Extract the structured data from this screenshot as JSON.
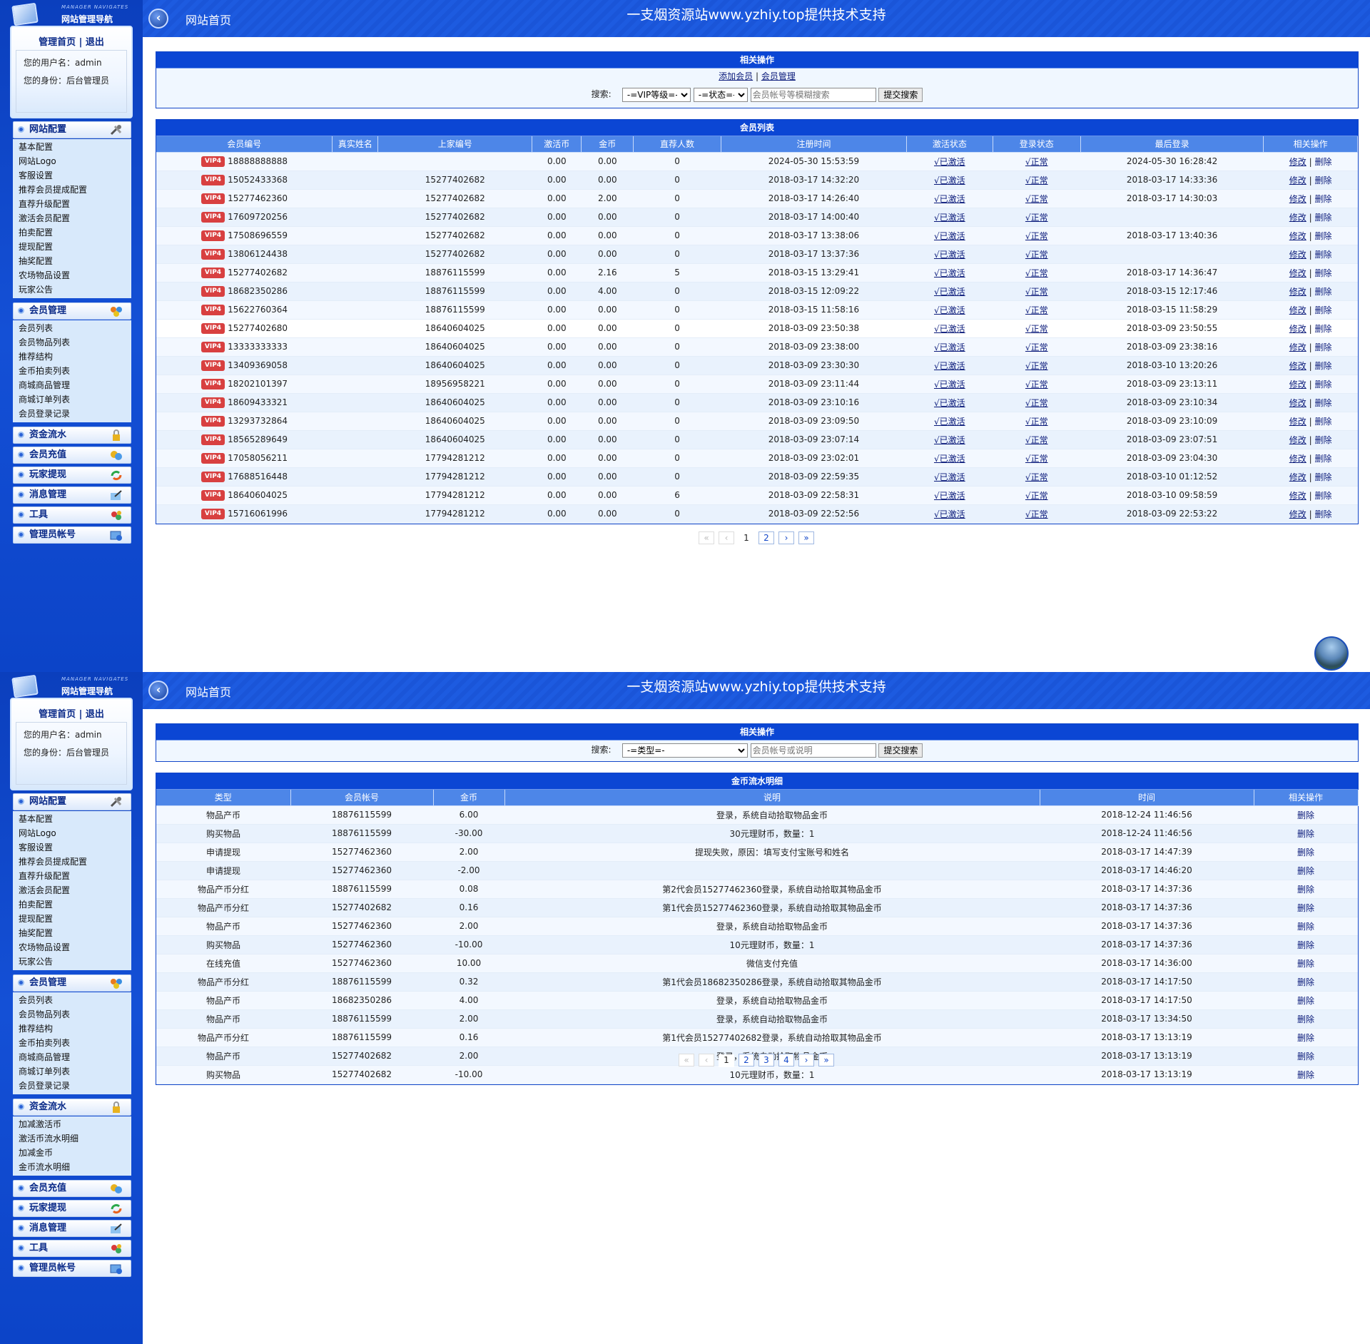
{
  "common": {
    "logo_sub": "MANAGER NAVIGATES",
    "logo_title": "网站管理导航",
    "admin_home": "管理首页",
    "sep": "|",
    "logout": "退出",
    "username_line": "您的用户名：admin",
    "role_line": "您的身份：后台管理员",
    "breadcrumb": "网站首页",
    "banner": "一支烟资源站www.yzhiy.top提供技术支持",
    "back_icon": "chevron-left-icon"
  },
  "menu": {
    "site_config": {
      "label": "网站配置",
      "items": [
        "基本配置",
        "网站Logo",
        "客服设置",
        "推荐会员提成配置",
        "直荐升级配置",
        "激活会员配置",
        "拍卖配置",
        "提现配置",
        "抽奖配置",
        "农场物品设置",
        "玩家公告"
      ]
    },
    "member": {
      "label": "会员管理",
      "items": [
        "会员列表",
        "会员物品列表",
        "推荐结构",
        "金币拍卖列表",
        "商城商品管理",
        "商城订单列表",
        "会员登录记录"
      ]
    },
    "funds": {
      "label": "资金流水",
      "items": [
        "加减激活币",
        "激活币流水明细",
        "加减金币",
        "金币流水明细"
      ]
    },
    "recharge": {
      "label": "会员充值"
    },
    "withdraw": {
      "label": "玩家提现"
    },
    "message": {
      "label": "消息管理"
    },
    "tools": {
      "label": "工具"
    },
    "admin": {
      "label": "管理员帐号"
    }
  },
  "shot1": {
    "ops_title": "相关操作",
    "add_member": "添加会员",
    "member_mgmt": "会员管理",
    "search_label": "搜索:",
    "vip_select": "-=VIP等级=-",
    "status_select": "-=状态=-",
    "search_placeholder": "会员帐号等模糊搜索",
    "submit": "提交搜索",
    "list_title": "会员列表",
    "columns": [
      "会员编号",
      "真实姓名",
      "上家编号",
      "激活币",
      "金币",
      "直荐人数",
      "注册时间",
      "激活状态",
      "登录状态",
      "最后登录",
      "相关操作"
    ],
    "vip_badge": "VIP4",
    "activated": "√已激活",
    "normal": "√正常",
    "edit": "修改",
    "delete": "删除",
    "rows": [
      [
        "18888888888",
        "",
        "",
        "0.00",
        "0.00",
        "0",
        "2024-05-30 15:53:59",
        "2024-05-30 16:28:42"
      ],
      [
        "15052433368",
        "",
        "15277402682",
        "0.00",
        "0.00",
        "0",
        "2018-03-17 14:32:20",
        "2018-03-17 14:33:36"
      ],
      [
        "15277462360",
        "",
        "15277402682",
        "0.00",
        "2.00",
        "0",
        "2018-03-17 14:26:40",
        "2018-03-17 14:30:03"
      ],
      [
        "17609720256",
        "",
        "15277402682",
        "0.00",
        "0.00",
        "0",
        "2018-03-17 14:00:40",
        ""
      ],
      [
        "17508696559",
        "",
        "15277402682",
        "0.00",
        "0.00",
        "0",
        "2018-03-17 13:38:06",
        "2018-03-17 13:40:36"
      ],
      [
        "13806124438",
        "",
        "15277402682",
        "0.00",
        "0.00",
        "0",
        "2018-03-17 13:37:36",
        ""
      ],
      [
        "15277402682",
        "",
        "18876115599",
        "0.00",
        "2.16",
        "5",
        "2018-03-15 13:29:41",
        "2018-03-17 14:36:47"
      ],
      [
        "18682350286",
        "",
        "18876115599",
        "0.00",
        "4.00",
        "0",
        "2018-03-15 12:09:22",
        "2018-03-15 12:17:46"
      ],
      [
        "15622760364",
        "",
        "18876115599",
        "0.00",
        "0.00",
        "0",
        "2018-03-15 11:58:16",
        "2018-03-15 11:58:29"
      ],
      [
        "15277402680",
        "",
        "18640604025",
        "0.00",
        "0.00",
        "0",
        "2018-03-09 23:50:38",
        "2018-03-09 23:50:55"
      ],
      [
        "13333333333",
        "",
        "18640604025",
        "0.00",
        "0.00",
        "0",
        "2018-03-09 23:38:00",
        "2018-03-09 23:38:16"
      ],
      [
        "13409369058",
        "",
        "18640604025",
        "0.00",
        "0.00",
        "0",
        "2018-03-09 23:30:30",
        "2018-03-10 13:20:26"
      ],
      [
        "18202101397",
        "",
        "18956958221",
        "0.00",
        "0.00",
        "0",
        "2018-03-09 23:11:44",
        "2018-03-09 23:13:11"
      ],
      [
        "18609433321",
        "",
        "18640604025",
        "0.00",
        "0.00",
        "0",
        "2018-03-09 23:10:16",
        "2018-03-09 23:10:34"
      ],
      [
        "13293732864",
        "",
        "18640604025",
        "0.00",
        "0.00",
        "0",
        "2018-03-09 23:09:50",
        "2018-03-09 23:10:09"
      ],
      [
        "18565289649",
        "",
        "18640604025",
        "0.00",
        "0.00",
        "0",
        "2018-03-09 23:07:14",
        "2018-03-09 23:07:51"
      ],
      [
        "17058056211",
        "",
        "17794281212",
        "0.00",
        "0.00",
        "0",
        "2018-03-09 23:02:01",
        "2018-03-09 23:04:30"
      ],
      [
        "17688516448",
        "",
        "17794281212",
        "0.00",
        "0.00",
        "0",
        "2018-03-09 22:59:35",
        "2018-03-10 01:12:52"
      ],
      [
        "18640604025",
        "",
        "17794281212",
        "0.00",
        "0.00",
        "6",
        "2018-03-09 22:58:31",
        "2018-03-10 09:58:59"
      ],
      [
        "15716061996",
        "",
        "17794281212",
        "0.00",
        "0.00",
        "0",
        "2018-03-09 22:52:56",
        "2018-03-09 22:53:22"
      ]
    ],
    "pager": [
      "«",
      "‹",
      "1",
      "2",
      "›",
      "»"
    ]
  },
  "shot2": {
    "ops_title": "相关操作",
    "search_label": "搜索:",
    "type_select": "-=类型=-",
    "search_placeholder": "会员帐号或说明",
    "submit": "提交搜索",
    "list_title": "金币流水明细",
    "columns": [
      "类型",
      "会员帐号",
      "金币",
      "说明",
      "时间",
      "相关操作"
    ],
    "delete": "删除",
    "rows": [
      [
        "物品产币",
        "18876115599",
        "6.00",
        "登录，系统自动拾取物品金币",
        "2018-12-24 11:46:56"
      ],
      [
        "购买物品",
        "18876115599",
        "-30.00",
        "30元理财币，数量：1",
        "2018-12-24 11:46:56"
      ],
      [
        "申请提现",
        "15277462360",
        "2.00",
        "提现失败，原因：填写支付宝账号和姓名",
        "2018-03-17 14:47:39"
      ],
      [
        "申请提现",
        "15277462360",
        "-2.00",
        "",
        "2018-03-17 14:46:20"
      ],
      [
        "物品产币分红",
        "18876115599",
        "0.08",
        "第2代会员15277462360登录，系统自动拾取其物品金币",
        "2018-03-17 14:37:36"
      ],
      [
        "物品产币分红",
        "15277402682",
        "0.16",
        "第1代会员15277462360登录，系统自动拾取其物品金币",
        "2018-03-17 14:37:36"
      ],
      [
        "物品产币",
        "15277462360",
        "2.00",
        "登录，系统自动拾取物品金币",
        "2018-03-17 14:37:36"
      ],
      [
        "购买物品",
        "15277462360",
        "-10.00",
        "10元理财币，数量：1",
        "2018-03-17 14:37:36"
      ],
      [
        "在线充值",
        "15277462360",
        "10.00",
        "微信支付充值",
        "2018-03-17 14:36:00"
      ],
      [
        "物品产币分红",
        "18876115599",
        "0.32",
        "第1代会员18682350286登录，系统自动拾取其物品金币",
        "2018-03-17 14:17:50"
      ],
      [
        "物品产币",
        "18682350286",
        "4.00",
        "登录，系统自动拾取物品金币",
        "2018-03-17 14:17:50"
      ],
      [
        "物品产币",
        "18876115599",
        "2.00",
        "登录，系统自动拾取物品金币",
        "2018-03-17 13:34:50"
      ],
      [
        "物品产币分红",
        "18876115599",
        "0.16",
        "第1代会员15277402682登录，系统自动拾取其物品金币",
        "2018-03-17 13:13:19"
      ],
      [
        "物品产币",
        "15277402682",
        "2.00",
        "登录，系统自动拾取物品金币",
        "2018-03-17 13:13:19"
      ],
      [
        "购买物品",
        "15277402682",
        "-10.00",
        "10元理财币，数量：1",
        "2018-03-17 13:13:19"
      ]
    ],
    "pager": [
      "«",
      "‹",
      "1",
      "2",
      "3",
      "4",
      "›",
      "»"
    ]
  }
}
